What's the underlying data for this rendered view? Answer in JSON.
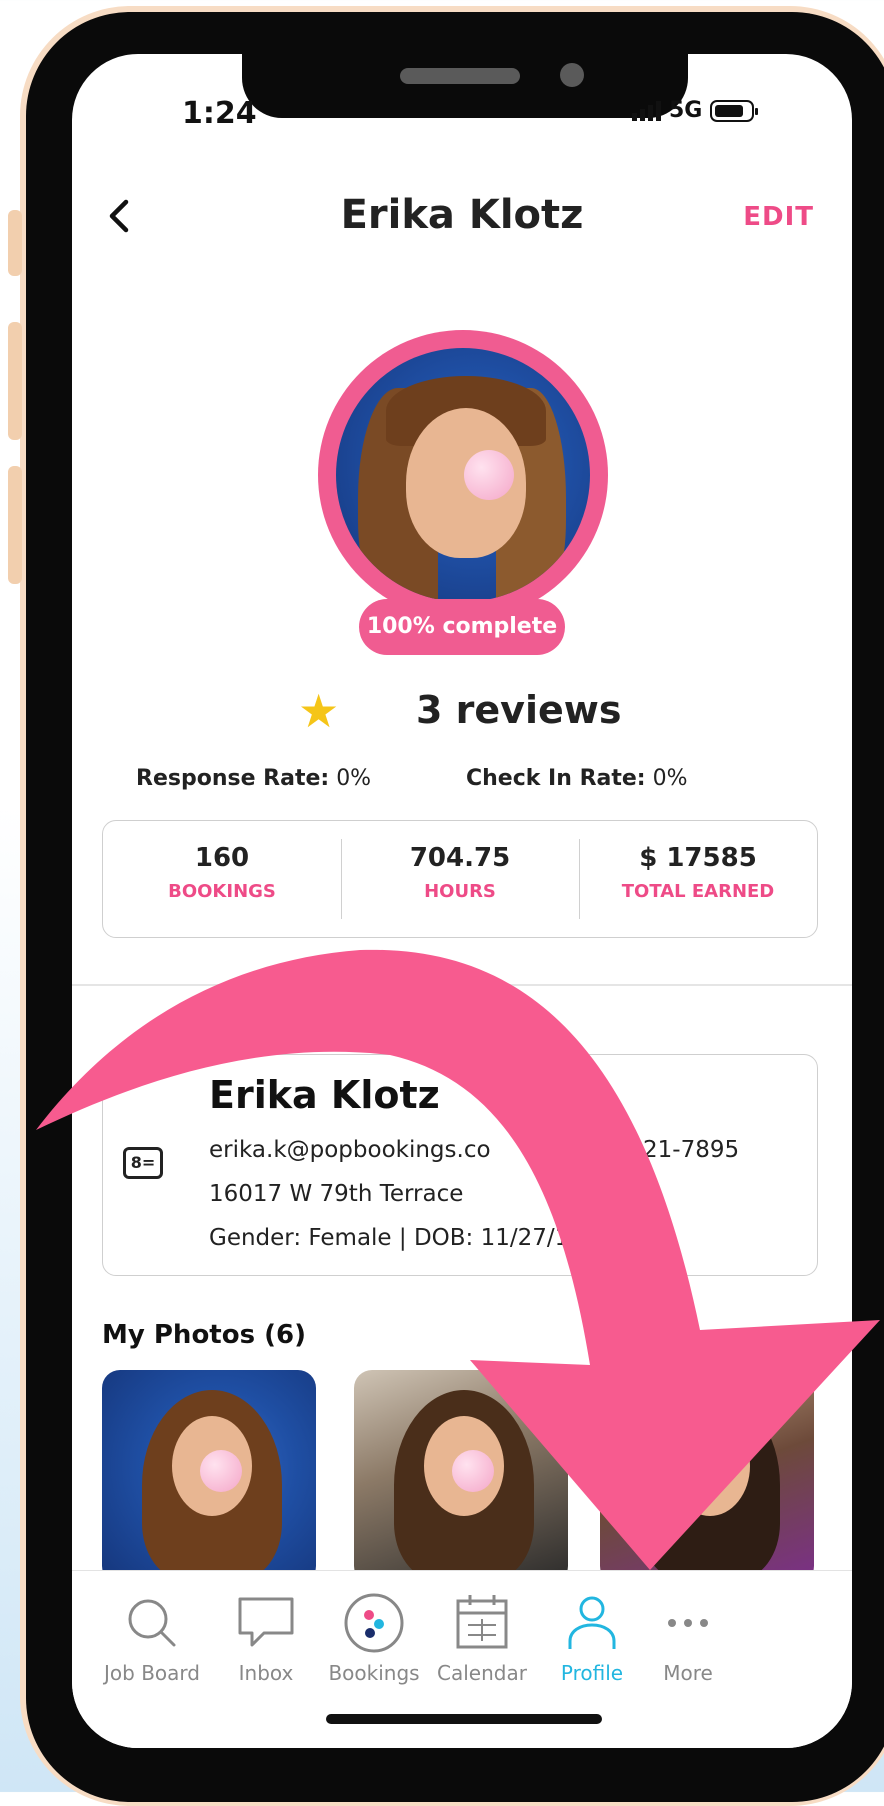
{
  "status_bar": {
    "time": "1:24",
    "network": "5G"
  },
  "header": {
    "title": "Erika Klotz",
    "edit_label": "EDIT"
  },
  "profile": {
    "completion": "100% complete",
    "reviews": "3 reviews"
  },
  "rates": {
    "response_label": "Response Rate:",
    "response_value": "0%",
    "checkin_label": "Check In Rate:",
    "checkin_value": "0%"
  },
  "stats": [
    {
      "value": "160",
      "label": "BOOKINGS"
    },
    {
      "value": "704.75",
      "label": "HOURS"
    },
    {
      "value": "$ 17585",
      "label": "TOTAL EARNED"
    }
  ],
  "info": {
    "name": "Erika Klotz",
    "email": "erika.k@popbookings.co",
    "phone": "21-7895",
    "address": "16017 W 79th Terrace",
    "details": "Gender: Female | DOB: 11/27/1"
  },
  "photos": {
    "title": "My Photos (6)"
  },
  "tabs": [
    {
      "label": "Job Board",
      "icon": "search-icon"
    },
    {
      "label": "Inbox",
      "icon": "chat-icon"
    },
    {
      "label": "Bookings",
      "icon": "bookings-icon"
    },
    {
      "label": "Calendar",
      "icon": "calendar-icon"
    },
    {
      "label": "Profile",
      "icon": "person-icon",
      "active": true
    },
    {
      "label": "More",
      "icon": "more-icon"
    }
  ],
  "colors": {
    "accent_pink": "#ee4b87",
    "active_tab": "#22b6e0",
    "star": "#f5c518"
  }
}
